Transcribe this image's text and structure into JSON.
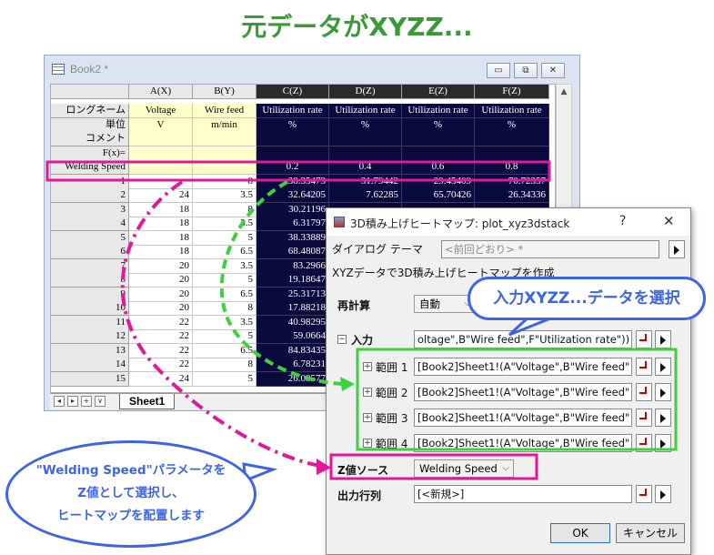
{
  "heading": "元データがXYZZ...",
  "book": {
    "title": "Book2 *",
    "buttons": {
      "minimize": "▭",
      "restore": "⧉",
      "close": "✕"
    },
    "sheet_tab": "Sheet1",
    "nav": [
      "◂",
      "▸",
      "+",
      "∨"
    ],
    "columns": [
      "A(X)",
      "B(Y)",
      "C(Z)",
      "D(Z)",
      "E(Z)",
      "F(Z)"
    ],
    "row_labels": {
      "longname": "ロングネーム",
      "units": "単位",
      "comment": "コメント",
      "fx": "F(x)=",
      "param": "Welding Speed"
    },
    "longnames": [
      "Voltage",
      "Wire feed",
      "Utilization rate",
      "Utilization rate",
      "Utilization rate",
      "Utilization rate"
    ],
    "units": [
      "V",
      "m/min",
      "%",
      "%",
      "%",
      "%"
    ],
    "param_values": [
      "",
      "",
      "0.2",
      "0.4",
      "0.6",
      "0.8"
    ],
    "rows": [
      [
        "1",
        "",
        "8",
        "38.35473",
        "31.79442",
        "29.45409",
        "70.72357"
      ],
      [
        "2",
        "24",
        "3.5",
        "32.64205",
        "7.62285",
        "65.70426",
        "26.34336"
      ],
      [
        "3",
        "18",
        "8",
        "30.21196",
        "",
        "",
        ""
      ],
      [
        "4",
        "18",
        "3.5",
        "6.31797",
        "",
        "",
        ""
      ],
      [
        "5",
        "18",
        "5",
        "38.33889",
        "",
        "",
        ""
      ],
      [
        "6",
        "18",
        "6.5",
        "68.48087",
        "",
        "",
        ""
      ],
      [
        "7",
        "20",
        "3.5",
        "83.2966",
        "",
        "",
        ""
      ],
      [
        "8",
        "20",
        "5",
        "19.18647",
        "",
        "",
        ""
      ],
      [
        "9",
        "20",
        "6.5",
        "25.31713",
        "",
        "",
        ""
      ],
      [
        "10",
        "20",
        "8",
        "17.88218",
        "",
        "",
        ""
      ],
      [
        "11",
        "22",
        "3.5",
        "40.98295",
        "",
        "",
        ""
      ],
      [
        "12",
        "22",
        "5",
        "59.0664",
        "",
        "",
        ""
      ],
      [
        "13",
        "22",
        "6.5",
        "84.83435",
        "",
        "",
        ""
      ],
      [
        "14",
        "22",
        "8",
        "6.78231",
        "",
        "",
        ""
      ],
      [
        "15",
        "24",
        "5",
        "26.08577",
        "",
        "",
        ""
      ]
    ]
  },
  "dialog": {
    "title": "3D積み上げヒートマップ: plot_xyz3dstack",
    "help": "?",
    "close": "✕",
    "theme_label": "ダイアログ テーマ",
    "theme_value": "<前回どおり> *",
    "description": "XYZデータで3D積み上げヒートマップを作成",
    "recalc_label": "再計算",
    "recalc_value": "自動",
    "input_label": "入力",
    "input_value": "oltage\",B\"Wire feed\",F\"Utilization rate\"))",
    "ranges": [
      {
        "label": "範囲 1",
        "value": "[Book2]Sheet1!(A\"Voltage\",B\"Wire feed\""
      },
      {
        "label": "範囲 2",
        "value": "[Book2]Sheet1!(A\"Voltage\",B\"Wire feed\""
      },
      {
        "label": "範囲 3",
        "value": "[Book2]Sheet1!(A\"Voltage\",B\"Wire feed\""
      },
      {
        "label": "範囲 4",
        "value": "[Book2]Sheet1!(A\"Voltage\",B\"Wire feed\""
      }
    ],
    "zsource_label": "Z値ソース",
    "zsource_value": "Welding Speed",
    "output_label": "出力行列",
    "output_value": "[<新規>]",
    "ok": "OK",
    "cancel": "キャンセル"
  },
  "callouts": {
    "top": "入力XYZZ...データを選択",
    "bottom_lines": [
      "\"Welding Speed\"パラメータを",
      "Z値として選択し、",
      "ヒートマップを配置します"
    ]
  },
  "colors": {
    "magenta": "#e0189a",
    "green": "#3fd03f",
    "blue": "#3d63e6",
    "title_green": "#3a9a3a"
  }
}
